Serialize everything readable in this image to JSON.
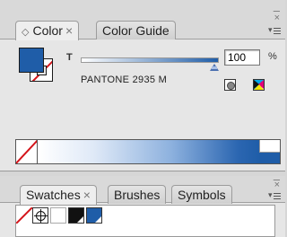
{
  "color_panel": {
    "tabs": [
      {
        "label": "Color",
        "active": true,
        "closable": true
      },
      {
        "label": "Color Guide",
        "active": false,
        "closable": false
      }
    ],
    "close_glyph": "×",
    "collapse_glyph": "–",
    "fill_color": "#1f5da8",
    "stroke": "none",
    "tint_label": "T",
    "tint_value": "100",
    "tint_unit": "%",
    "tint_fraction": 1.0,
    "swatch_name": "PANTONE 2935 M",
    "mode_icons": [
      "grayscale-mode-icon",
      "cmyk-mode-icon"
    ]
  },
  "swatches_panel": {
    "tabs": [
      {
        "label": "Swatches",
        "active": true,
        "closable": true
      },
      {
        "label": "Brushes",
        "active": false,
        "closable": false
      },
      {
        "label": "Symbols",
        "active": false,
        "closable": false
      }
    ],
    "close_glyph": "×",
    "collapse_glyph": "–",
    "swatches": [
      {
        "name": "None",
        "color": "none"
      },
      {
        "name": "Registration",
        "color": "#000000"
      },
      {
        "name": "White",
        "color": "#ffffff"
      },
      {
        "name": "Black",
        "color": "#000000"
      },
      {
        "name": "PANTONE 2935 M",
        "color": "#1f5da8"
      }
    ]
  },
  "colors": {
    "accent": "#1f5da8",
    "none_slash": "#d4141a"
  }
}
